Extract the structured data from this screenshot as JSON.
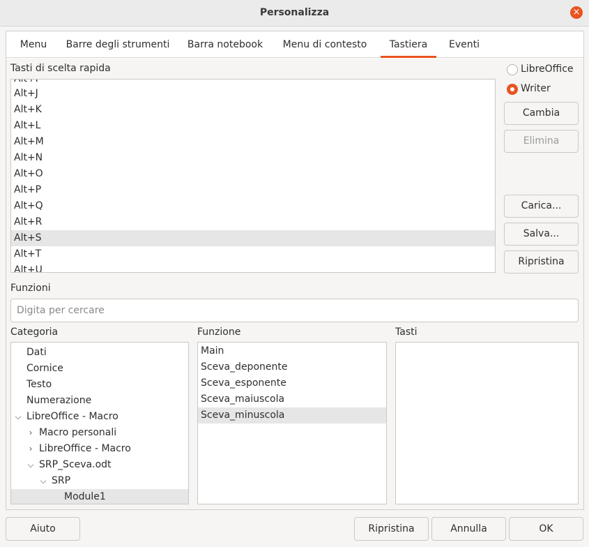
{
  "window": {
    "title": "Personalizza",
    "close_icon": "×"
  },
  "tabs": [
    {
      "label": "Menu"
    },
    {
      "label": "Barre degli strumenti"
    },
    {
      "label": "Barra notebook"
    },
    {
      "label": "Menu di contesto"
    },
    {
      "label": "Tastiera",
      "active": true
    },
    {
      "label": "Eventi"
    }
  ],
  "shortcuts": {
    "label": "Tasti di scelta rapida",
    "items": [
      "Alt+I",
      "Alt+J",
      "Alt+K",
      "Alt+L",
      "Alt+M",
      "Alt+N",
      "Alt+O",
      "Alt+P",
      "Alt+Q",
      "Alt+R",
      "Alt+S",
      "Alt+T",
      "Alt+U"
    ],
    "selected": "Alt+S"
  },
  "scope": {
    "options": [
      {
        "label": "LibreOffice",
        "checked": false
      },
      {
        "label": "Writer",
        "checked": true
      }
    ]
  },
  "buttons": {
    "change": "Cambia",
    "delete": "Elimina",
    "load": "Carica...",
    "save": "Salva...",
    "reset": "Ripristina"
  },
  "functions": {
    "label": "Funzioni",
    "search_placeholder": "Digita per cercare"
  },
  "category": {
    "label": "Categoria",
    "items": [
      {
        "label": "Dati",
        "expander": ""
      },
      {
        "label": "Cornice",
        "expander": ""
      },
      {
        "label": "Testo",
        "expander": ""
      },
      {
        "label": "Numerazione",
        "expander": ""
      },
      {
        "label": "LibreOffice - Macro",
        "expander": "expanded"
      },
      {
        "label": "Macro personali",
        "expander": "collapsed"
      },
      {
        "label": "LibreOffice - Macro",
        "expander": "collapsed"
      },
      {
        "label": "SRP_Sceva.odt",
        "expander": "expanded"
      },
      {
        "label": "SRP",
        "expander": "expanded"
      },
      {
        "label": "Module1",
        "expander": "",
        "selected": true
      }
    ]
  },
  "function_list": {
    "label": "Funzione",
    "items": [
      "Main",
      "Sceva_deponente",
      "Sceva_esponente",
      "Sceva_maiuscola",
      "Sceva_minuscola"
    ],
    "selected": "Sceva_minuscola"
  },
  "keys": {
    "label": "Tasti"
  },
  "footer": {
    "help": "Aiuto",
    "reset": "Ripristina",
    "cancel": "Annulla",
    "ok": "OK"
  },
  "colors": {
    "accent": "#e95420",
    "selection": "#e6e6e6"
  }
}
